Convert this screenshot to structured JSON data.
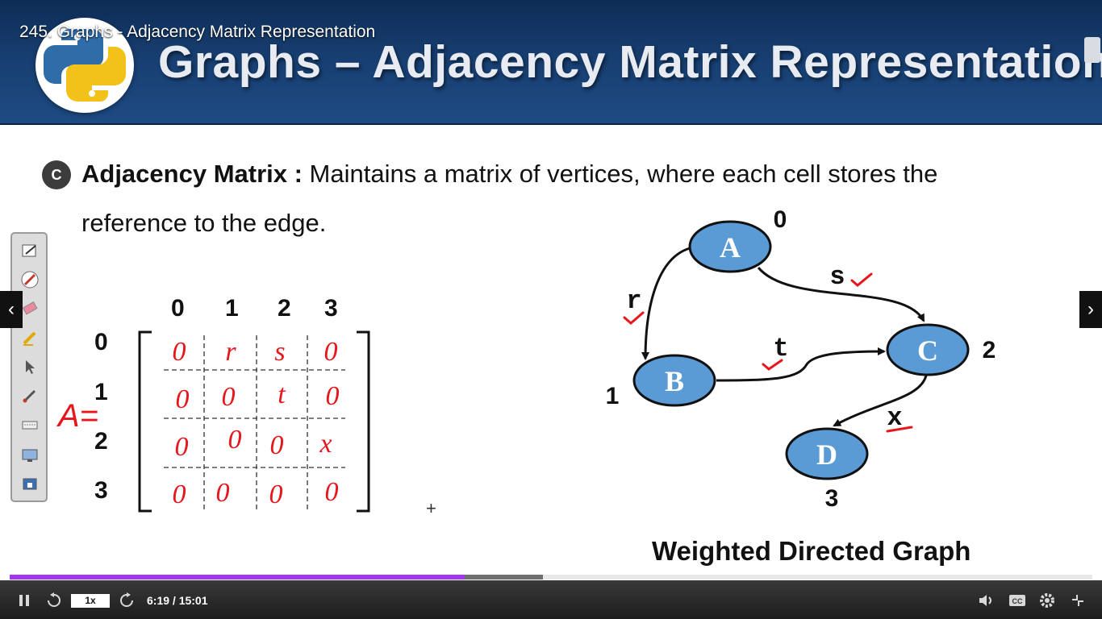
{
  "video": {
    "title": "245. Graphs - Adjacency Matrix Representation"
  },
  "slide": {
    "title": "Graphs – Adjacency Matrix Representation",
    "bullet_letter": "C",
    "term": "Adjacency Matrix :",
    "definition_line1": " Maintains a matrix of vertices, where each cell stores the",
    "definition_line2": "reference to the edge."
  },
  "matrix": {
    "label": "A=",
    "col_headers": [
      "0",
      "1",
      "2",
      "3"
    ],
    "row_headers": [
      "0",
      "1",
      "2",
      "3"
    ],
    "cells": [
      [
        "0",
        "r",
        "s",
        "0"
      ],
      [
        "0",
        "0",
        "t",
        "0"
      ],
      [
        "0",
        "0",
        "0",
        "x"
      ],
      [
        "0",
        "0",
        "0",
        "0"
      ]
    ]
  },
  "graph": {
    "caption": "Weighted Directed Graph",
    "nodes": [
      {
        "name": "A",
        "index": "0"
      },
      {
        "name": "B",
        "index": "1"
      },
      {
        "name": "C",
        "index": "2"
      },
      {
        "name": "D",
        "index": "3"
      }
    ],
    "edges": [
      {
        "from": "A",
        "to": "B",
        "label": "r"
      },
      {
        "from": "A",
        "to": "C",
        "label": "s"
      },
      {
        "from": "B",
        "to": "C",
        "label": "t"
      },
      {
        "from": "C",
        "to": "D",
        "label": "x"
      }
    ]
  },
  "player": {
    "speed": "1x",
    "current_time": "6:19",
    "duration": "15:01",
    "time_display": "6:19 / 15:01",
    "progress_fraction": 0.421,
    "buffered_fraction": 0.493,
    "colors": {
      "progress": "#a435f0",
      "buffer": "#6f6f6f",
      "header": "#1e4b84",
      "node": "#5b9bd5",
      "ink": "#e6161c"
    }
  },
  "toolbar_icons": [
    "pen-icon",
    "highlighter-icon",
    "eraser-icon",
    "marker-icon",
    "pointer-icon",
    "brush-icon",
    "keyboard-icon",
    "screen-icon",
    "settings-tool-icon"
  ]
}
